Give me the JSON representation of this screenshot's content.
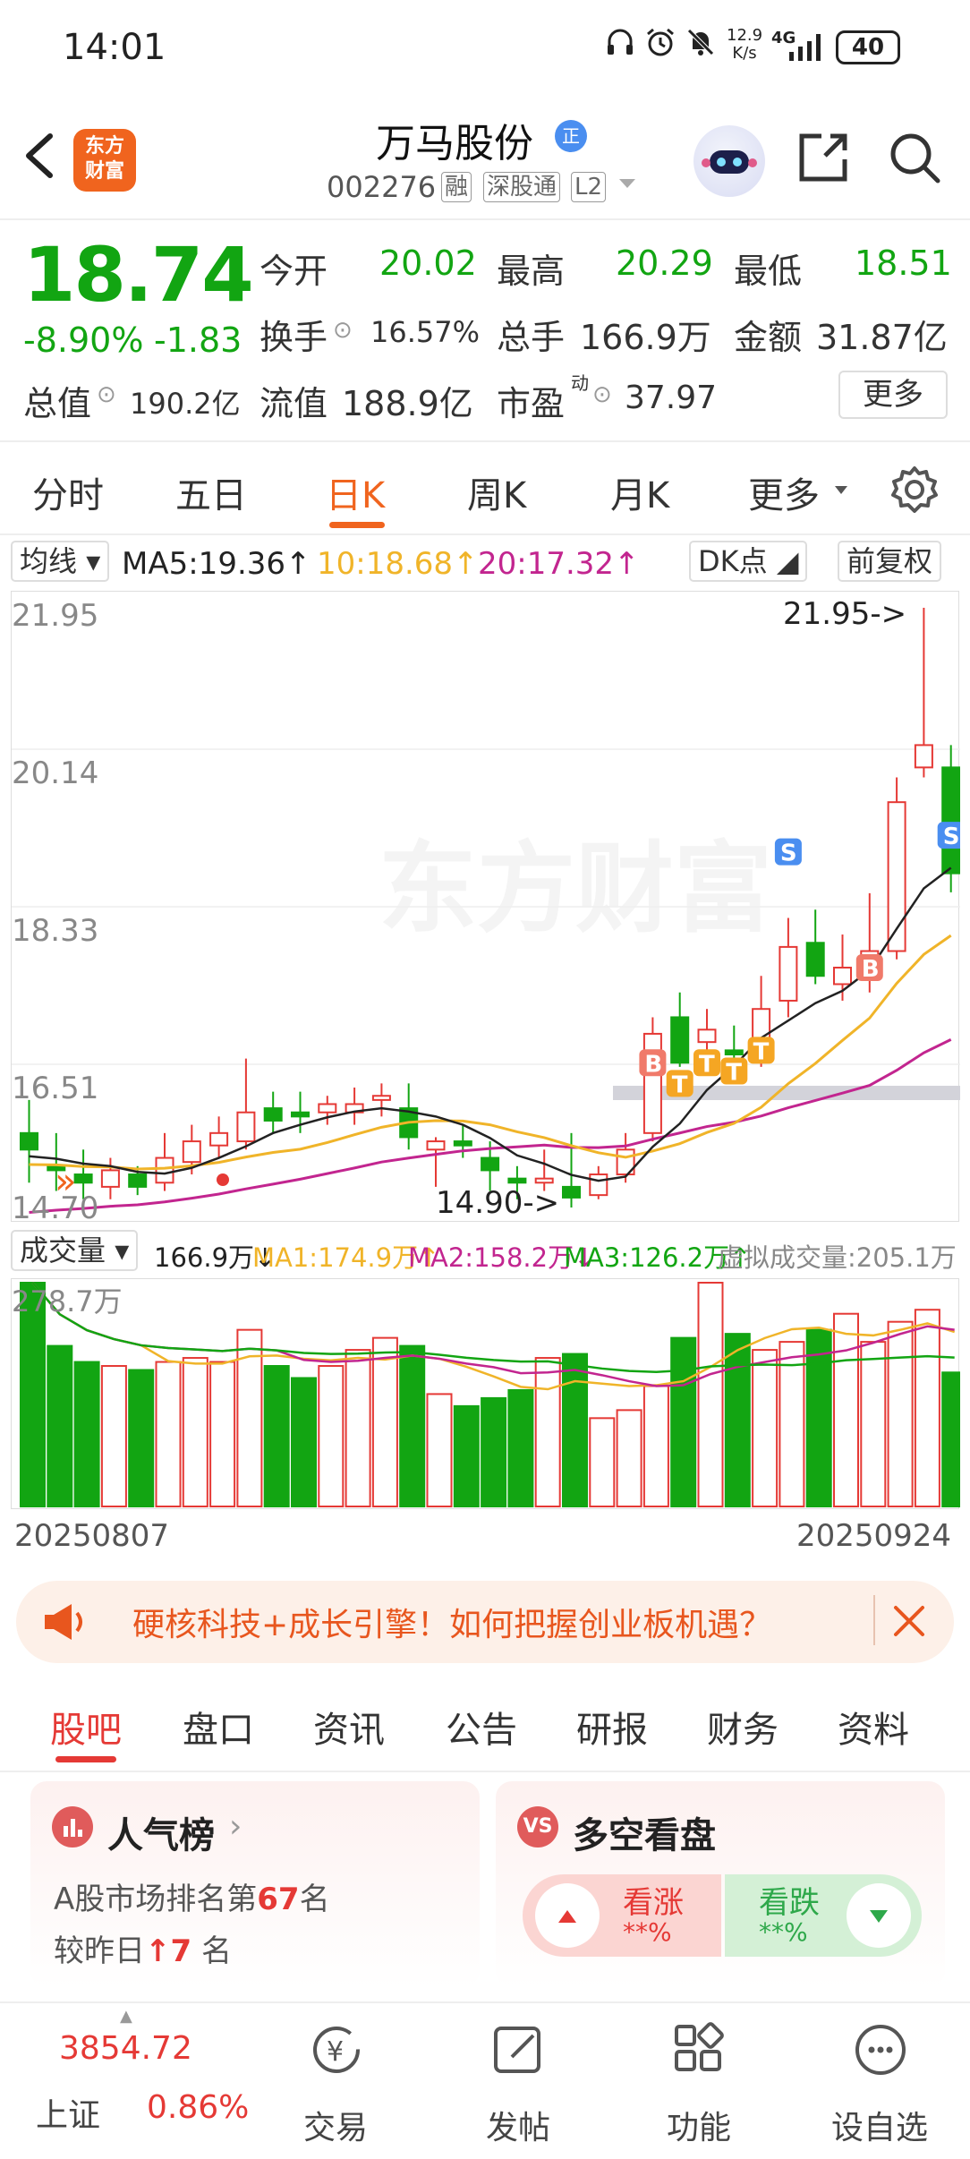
{
  "status": {
    "time": "14:01",
    "net_speed_top": "12.9",
    "net_speed_bottom": "K/s",
    "network": "4G",
    "battery": "40"
  },
  "header": {
    "title": "万马股份",
    "badge": "正",
    "code": "002276",
    "tags": [
      "融",
      "深股通",
      "L2"
    ],
    "logo_text_1": "东方",
    "logo_text_2": "财富"
  },
  "quote": {
    "price": "18.74",
    "change_pct": "-8.90%",
    "change": "-1.83",
    "open_label": "今开",
    "open": "20.02",
    "high_label": "最高",
    "high": "20.29",
    "low_label": "最低",
    "low": "18.51",
    "turnover_label": "换手",
    "turnover": "16.57%",
    "volume_label": "总手",
    "volume": "166.9万",
    "amount_label": "金额",
    "amount": "31.87亿",
    "mcap_label": "总值",
    "mcap": "190.2亿",
    "float_label": "流值",
    "float": "188.9亿",
    "pe_label": "市盈",
    "pe_sup": "动",
    "pe": "37.97",
    "more": "更多"
  },
  "chart_tabs": [
    "分时",
    "五日",
    "日K",
    "周K",
    "月K",
    "更多"
  ],
  "ma": {
    "selector": "均线",
    "ma5": "MA5:19.36",
    "ma10": "10:18.68",
    "ma20": "20:17.32",
    "dk": "DK点",
    "fq": "前复权"
  },
  "colors": {
    "up": "#e53935",
    "down": "#12a512",
    "accent": "#f0641e",
    "ma5": "#222222",
    "ma10": "#f0b429",
    "ma20": "#c2258f"
  },
  "axis": {
    "y_labels": [
      "21.95",
      "20.14",
      "18.33",
      "16.51",
      "14.70"
    ],
    "max_label": "21.95->",
    "min_label": "14.90->",
    "start_date": "20250807",
    "end_date": "20250924"
  },
  "volume": {
    "selector": "成交量",
    "vol": "166.9万",
    "ma1": "MA1:174.9万",
    "ma2": "MA2:158.2万",
    "ma3": "MA3:126.2万",
    "virtual": "虚拟成交量:205.1万",
    "max_label": "278.7万"
  },
  "watermark": "东方财富",
  "ad": {
    "text": "硬核科技+成长引擎！如何把握创业板机遇？"
  },
  "bottom_tabs": [
    "股吧",
    "盘口",
    "资讯",
    "公告",
    "研报",
    "财务",
    "资料"
  ],
  "popularity": {
    "title": "人气榜",
    "rank_prefix": "A股市场排名第",
    "rank": "67",
    "rank_suffix": "名",
    "change_prefix": "较昨日",
    "change": "7",
    "change_suffix": "名"
  },
  "sentiment": {
    "title": "多空看盘",
    "bull": "看涨",
    "bear": "看跌",
    "bull_pct": "**%",
    "bear_pct": "**%"
  },
  "footer": {
    "index_value": "3854.72",
    "index_name": "上证",
    "index_pct": "0.86%",
    "items": [
      "交易",
      "发帖",
      "功能",
      "设自选"
    ]
  },
  "chart_data": {
    "type": "candlestick",
    "title": "",
    "y_range": [
      14.7,
      21.95
    ],
    "candles": [
      {
        "o": 15.6,
        "c": 15.4,
        "h": 16.0,
        "l": 15.0
      },
      {
        "o": 15.2,
        "c": 15.15,
        "h": 15.6,
        "l": 14.9
      },
      {
        "o": 15.1,
        "c": 15.0,
        "h": 15.4,
        "l": 14.8
      },
      {
        "o": 14.95,
        "c": 15.15,
        "h": 15.3,
        "l": 14.8
      },
      {
        "o": 15.1,
        "c": 14.95,
        "h": 15.2,
        "l": 14.85
      },
      {
        "o": 15.0,
        "c": 15.3,
        "h": 15.6,
        "l": 14.9
      },
      {
        "o": 15.25,
        "c": 15.5,
        "h": 15.7,
        "l": 15.1
      },
      {
        "o": 15.45,
        "c": 15.6,
        "h": 15.8,
        "l": 15.3
      },
      {
        "o": 15.5,
        "c": 15.85,
        "h": 16.5,
        "l": 15.4
      },
      {
        "o": 15.9,
        "c": 15.75,
        "h": 16.1,
        "l": 15.6
      },
      {
        "o": 15.85,
        "c": 15.8,
        "h": 16.1,
        "l": 15.6
      },
      {
        "o": 15.85,
        "c": 15.95,
        "h": 16.05,
        "l": 15.7
      },
      {
        "o": 15.85,
        "c": 15.95,
        "h": 16.15,
        "l": 15.7
      },
      {
        "o": 16.0,
        "c": 16.05,
        "h": 16.2,
        "l": 15.8
      },
      {
        "o": 15.9,
        "c": 15.55,
        "h": 16.2,
        "l": 15.4
      },
      {
        "o": 15.4,
        "c": 15.5,
        "h": 15.55,
        "l": 14.95
      },
      {
        "o": 15.5,
        "c": 15.45,
        "h": 15.7,
        "l": 15.3
      },
      {
        "o": 15.3,
        "c": 15.15,
        "h": 15.5,
        "l": 14.9
      },
      {
        "o": 15.05,
        "c": 15.0,
        "h": 15.2,
        "l": 14.8
      },
      {
        "o": 15.0,
        "c": 15.05,
        "h": 15.4,
        "l": 14.9
      },
      {
        "o": 14.95,
        "c": 14.82,
        "h": 15.6,
        "l": 14.7
      },
      {
        "o": 14.85,
        "c": 15.1,
        "h": 15.2,
        "l": 14.8
      },
      {
        "o": 15.1,
        "c": 15.4,
        "h": 15.6,
        "l": 15.0
      },
      {
        "o": 15.6,
        "c": 16.8,
        "h": 17.0,
        "l": 15.5
      },
      {
        "o": 17.0,
        "c": 16.45,
        "h": 17.3,
        "l": 16.4
      },
      {
        "o": 16.7,
        "c": 16.85,
        "h": 17.1,
        "l": 16.5
      },
      {
        "o": 16.6,
        "c": 16.55,
        "h": 16.9,
        "l": 16.3
      },
      {
        "o": 16.6,
        "c": 17.1,
        "h": 17.5,
        "l": 16.4
      },
      {
        "o": 17.2,
        "c": 17.85,
        "h": 18.2,
        "l": 17.0
      },
      {
        "o": 17.9,
        "c": 17.5,
        "h": 18.3,
        "l": 17.4
      },
      {
        "o": 17.4,
        "c": 17.6,
        "h": 18.0,
        "l": 17.2
      },
      {
        "o": 17.5,
        "c": 17.8,
        "h": 18.5,
        "l": 17.3
      },
      {
        "o": 17.8,
        "c": 19.6,
        "h": 19.9,
        "l": 17.7
      },
      {
        "o": 20.02,
        "c": 20.29,
        "h": 21.95,
        "l": 19.9
      },
      {
        "o": 20.02,
        "c": 18.74,
        "h": 20.29,
        "l": 18.51
      }
    ],
    "volumes": [
      278.7,
      200,
      180,
      175,
      170,
      180,
      185,
      180,
      220,
      175,
      160,
      175,
      195,
      210,
      200,
      140,
      125,
      135,
      145,
      185,
      190,
      110,
      120,
      150,
      210,
      278.7,
      215,
      195,
      205,
      220,
      240,
      205,
      230,
      245,
      166.9
    ]
  }
}
